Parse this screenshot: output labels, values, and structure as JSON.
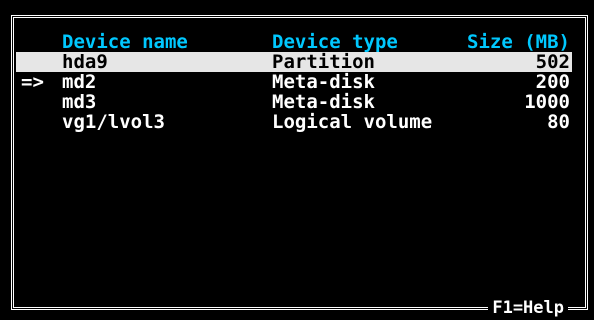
{
  "columns": {
    "name": "Device name",
    "type": "Device type",
    "size": "Size (MB)"
  },
  "rows": [
    {
      "marker": "",
      "name": "hda9",
      "type": "Partition",
      "size": "502",
      "selected": true
    },
    {
      "marker": "=>",
      "name": "md2",
      "type": "Meta-disk",
      "size": "200",
      "selected": false
    },
    {
      "marker": "",
      "name": "md3",
      "type": "Meta-disk",
      "size": "1000",
      "selected": false
    },
    {
      "marker": "",
      "name": "vg1/lvol3",
      "type": "Logical volume",
      "size": "80",
      "selected": false
    }
  ],
  "help": "F1=Help",
  "colors": {
    "background": "#000000",
    "text": "#ffffff",
    "header": "#00c8ff",
    "selection": "#e6e6e6"
  }
}
